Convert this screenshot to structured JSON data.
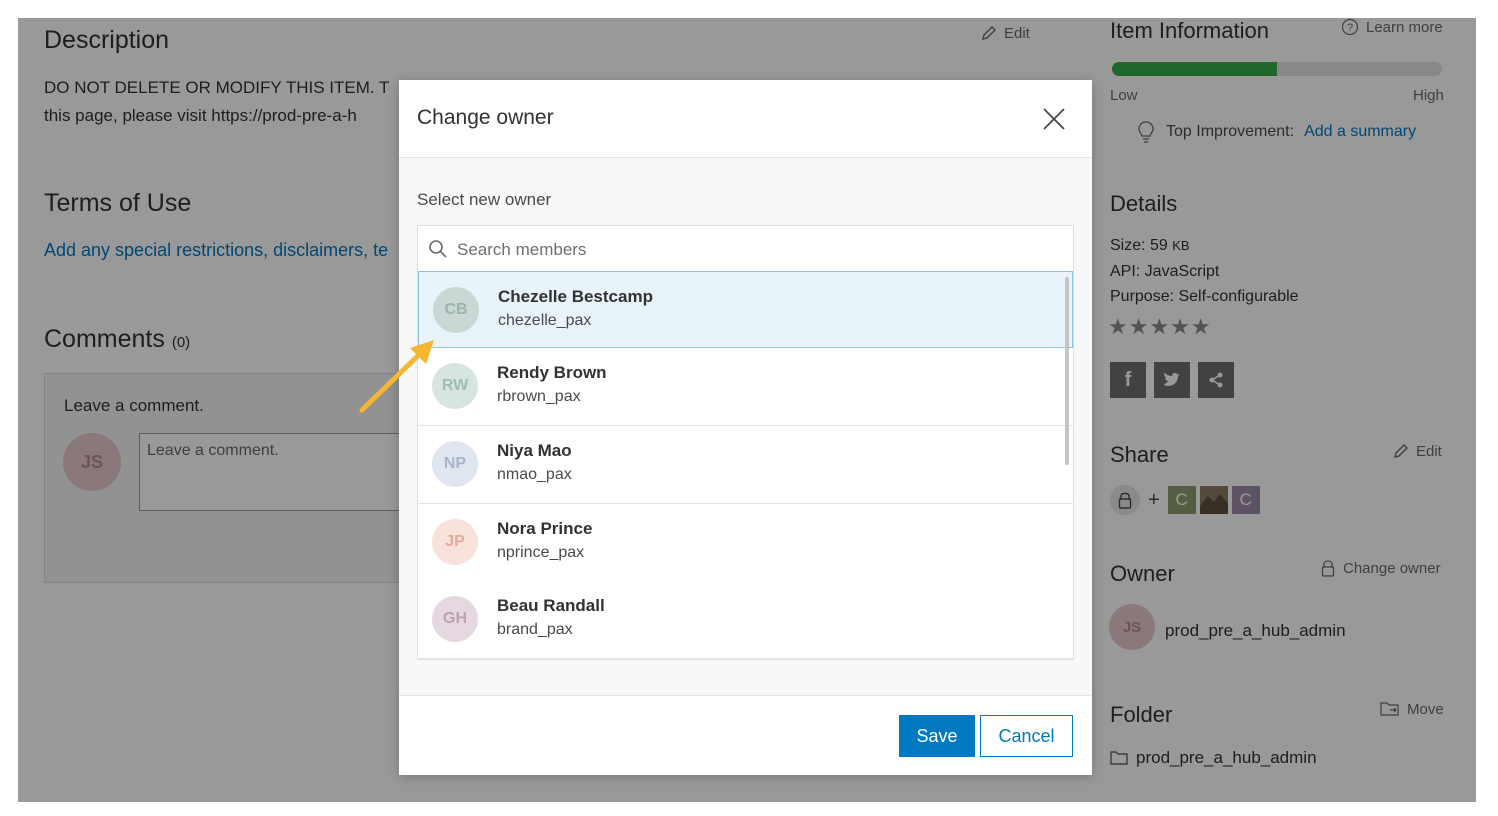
{
  "page": {
    "description": {
      "title": "Description",
      "edit_label": "Edit",
      "line1": "DO NOT DELETE OR MODIFY THIS ITEM. T",
      "line2": "this page, please visit https://prod-pre-a-h"
    },
    "terms": {
      "title": "Terms of Use",
      "link_text": "Add any special restrictions, disclaimers, te"
    },
    "comments": {
      "title": "Comments",
      "count": "(0)",
      "leave_label": "Leave a comment.",
      "input_placeholder": "Leave a comment.",
      "avatar_initials": "JS"
    },
    "item_information": {
      "title": "Item Information",
      "learn_more": "Learn more",
      "low_label": "Low",
      "high_label": "High",
      "progress_fraction": 0.5,
      "top_improvement_label": "Top Improvement:",
      "top_improvement_link": "Add a summary"
    },
    "details": {
      "title": "Details",
      "size_label": "Size: 59",
      "size_unit": "KB",
      "api": "API: JavaScript",
      "purpose": "Purpose: Self-configurable",
      "rating_stars": "★★★★★"
    },
    "share": {
      "title": "Share",
      "edit_label": "Edit",
      "plus": "+",
      "group_c1": "C",
      "group_c2": "C"
    },
    "owner": {
      "title": "Owner",
      "change_owner_label": "Change owner",
      "avatar_initials": "JS",
      "username": "prod_pre_a_hub_admin"
    },
    "folder": {
      "title": "Folder",
      "move_label": "Move",
      "name": "prod_pre_a_hub_admin"
    }
  },
  "modal": {
    "title": "Change owner",
    "select_label": "Select new owner",
    "search_placeholder": "Search members",
    "members": [
      {
        "initials": "CB",
        "name": "Chezelle Bestcamp",
        "username": "chezelle_pax",
        "selected": true
      },
      {
        "initials": "RW",
        "name": "Rendy Brown",
        "username": "rbrown_pax",
        "selected": false
      },
      {
        "initials": "NP",
        "name": "Niya Mao",
        "username": "nmao_pax",
        "selected": false
      },
      {
        "initials": "JP",
        "name": "Nora Prince",
        "username": "nprince_pax",
        "selected": false
      },
      {
        "initials": "GH",
        "name": "Beau Randall",
        "username": "brand_pax",
        "selected": false
      }
    ],
    "save_label": "Save",
    "cancel_label": "Cancel"
  },
  "colors": {
    "accent": "#0079c1",
    "selected_bg": "#e9f3fa",
    "arrow": "#f5b731",
    "quality_fill": "#35ac46"
  }
}
